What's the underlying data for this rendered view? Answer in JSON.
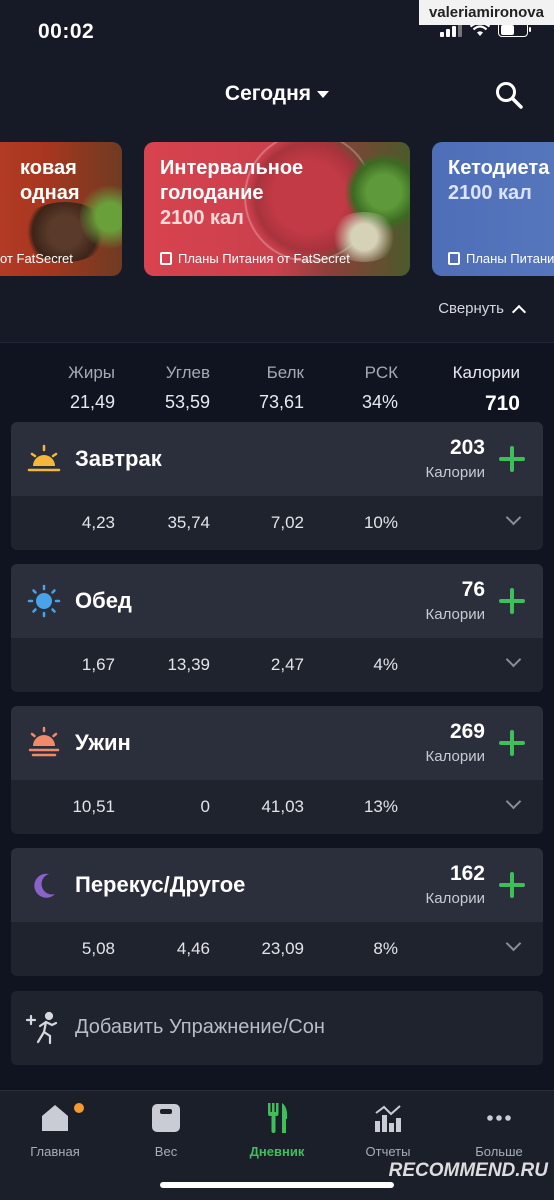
{
  "status_bar": {
    "time": "00:02",
    "user_watermark": "valeriamironova"
  },
  "header": {
    "title": "Сегодня",
    "search_icon": "search-icon"
  },
  "plans": [
    {
      "title_line1": "ковая",
      "title_line2": "одная",
      "footer": "от FatSecret",
      "color": "#b8402b"
    },
    {
      "title_line1": "Интервальное",
      "title_line2": "голодание",
      "kcal": "2100 кал",
      "footer": "Планы Питания от FatSecret",
      "color": "#d8434f"
    },
    {
      "title_line1": "Кетодиета",
      "kcal": "2100 кал",
      "footer": "Планы Питания",
      "color": "#4e6fb8"
    }
  ],
  "collapse_label": "Свернуть",
  "totals": {
    "fat_label": "Жиры",
    "fat": "21,49",
    "carbs_label": "Углев",
    "carbs": "53,59",
    "protein_label": "Белк",
    "protein": "73,61",
    "rdi_label": "РСК",
    "rdi": "34%",
    "calories_label": "Калории",
    "calories": "710"
  },
  "meals": [
    {
      "name": "Завтрак",
      "icon": "sunrise-icon",
      "calories": "203",
      "calories_label": "Калории",
      "fat": "4,23",
      "carbs": "35,74",
      "protein": "7,02",
      "rdi": "10%"
    },
    {
      "name": "Обед",
      "icon": "sun-icon",
      "calories": "76",
      "calories_label": "Калории",
      "fat": "1,67",
      "carbs": "13,39",
      "protein": "2,47",
      "rdi": "4%"
    },
    {
      "name": "Ужин",
      "icon": "sunset-icon",
      "calories": "269",
      "calories_label": "Калории",
      "fat": "10,51",
      "carbs": "0",
      "protein": "41,03",
      "rdi": "13%"
    },
    {
      "name": "Перекус/Другое",
      "icon": "moon-icon",
      "calories": "162",
      "calories_label": "Калории",
      "fat": "5,08",
      "carbs": "4,46",
      "protein": "23,09",
      "rdi": "8%"
    }
  ],
  "exercise_label": "Добавить Упражнение/Сон",
  "tabs": [
    {
      "label": "Главная",
      "icon": "home-icon"
    },
    {
      "label": "Вес",
      "icon": "scale-icon"
    },
    {
      "label": "Дневник",
      "icon": "fork-knife-icon",
      "active": true
    },
    {
      "label": "Отчеты",
      "icon": "chart-icon"
    },
    {
      "label": "Больше",
      "icon": "more-icon"
    }
  ],
  "watermark": "RECOMMEND.RU",
  "colors": {
    "accent": "#3fbf5a",
    "notification": "#f49a2e",
    "background": "#0f1420"
  }
}
